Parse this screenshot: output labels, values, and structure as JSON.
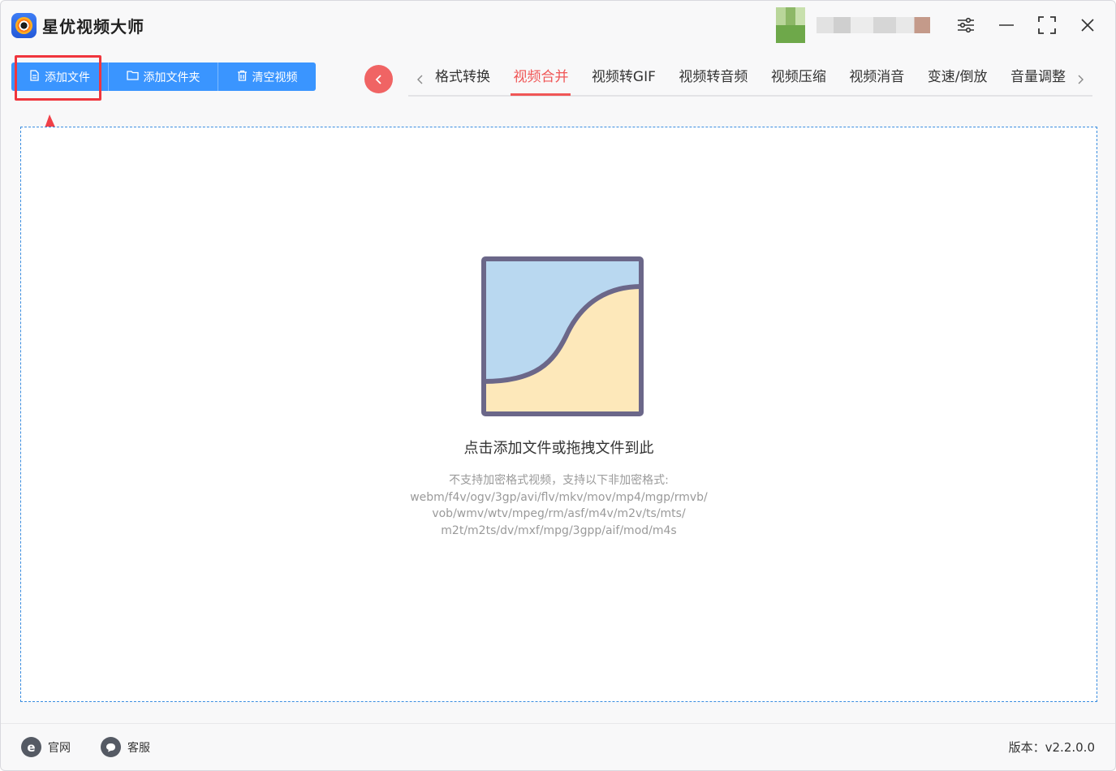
{
  "app": {
    "title": "星优视频大师"
  },
  "toolbar": {
    "add_file": "添加文件",
    "add_folder": "添加文件夹",
    "clear_videos": "清空视频"
  },
  "tabs": [
    {
      "label": "格式转换",
      "active": false
    },
    {
      "label": "视频合并",
      "active": true
    },
    {
      "label": "视频转GIF",
      "active": false
    },
    {
      "label": "视频转音频",
      "active": false
    },
    {
      "label": "视频压缩",
      "active": false
    },
    {
      "label": "视频消音",
      "active": false
    },
    {
      "label": "变速/倒放",
      "active": false
    },
    {
      "label": "音量调整",
      "active": false
    }
  ],
  "dropzone": {
    "title": "点击添加文件或拖拽文件到此",
    "note_lines": [
      "不支持加密格式视频，支持以下非加密格式:",
      "webm/f4v/ogv/3gp/avi/flv/mkv/mov/mp4/mgp/rmvb/",
      "vob/wmv/wtv/mpeg/rm/asf/m4v/m2v/ts/mts/",
      "m2t/m2ts/dv/mxf/mpg/3gpp/aif/mod/m4s"
    ]
  },
  "footer": {
    "website": "官网",
    "service": "客服",
    "version": "版本：v2.2.0.0"
  },
  "colors": {
    "accent_blue": "#3a95ff",
    "active_tab": "#f05656",
    "highlight_red": "#f0353d"
  }
}
